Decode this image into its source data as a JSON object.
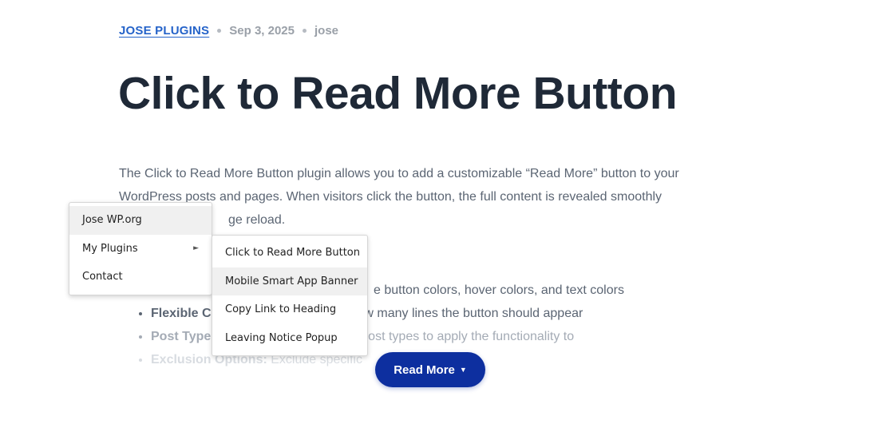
{
  "meta": {
    "category": "JOSE PLUGINS",
    "date": "Sep 3, 2025",
    "author": "jose"
  },
  "post": {
    "title": "Click to Read More Button",
    "intro_line1": "The Click to Read More Button plugin allows you to add a customizable “Read More” button to your",
    "intro_line2": "WordPress posts and pages. When visitors click the button, the full content is revealed smoothly",
    "intro_line3_visible": "ge reload.",
    "features": [
      {
        "label": "",
        "text": "e button colors, hover colors, and text colors"
      },
      {
        "label": "Flexible C",
        "text": "how many lines the button should appear"
      },
      {
        "label": "Post Type",
        "text": "post types to apply the functionality to"
      },
      {
        "label": "Exclusion Options:",
        "text": " Exclude specific"
      }
    ]
  },
  "context_menu": {
    "items": [
      {
        "label": "Jose WP.org"
      },
      {
        "label": "My Plugins",
        "arrow": "►"
      },
      {
        "label": "Contact"
      }
    ],
    "submenu": [
      {
        "label": "Click to Read More Button"
      },
      {
        "label": "Mobile Smart App Banner"
      },
      {
        "label": "Copy Link to Heading"
      },
      {
        "label": "Leaving Notice Popup"
      }
    ]
  },
  "read_more": {
    "label": "Read More",
    "caret": "▼"
  },
  "colors": {
    "accent": "#2563c9",
    "button": "#0d2f9f",
    "title": "#1f2937",
    "body_text": "#5b6573"
  }
}
